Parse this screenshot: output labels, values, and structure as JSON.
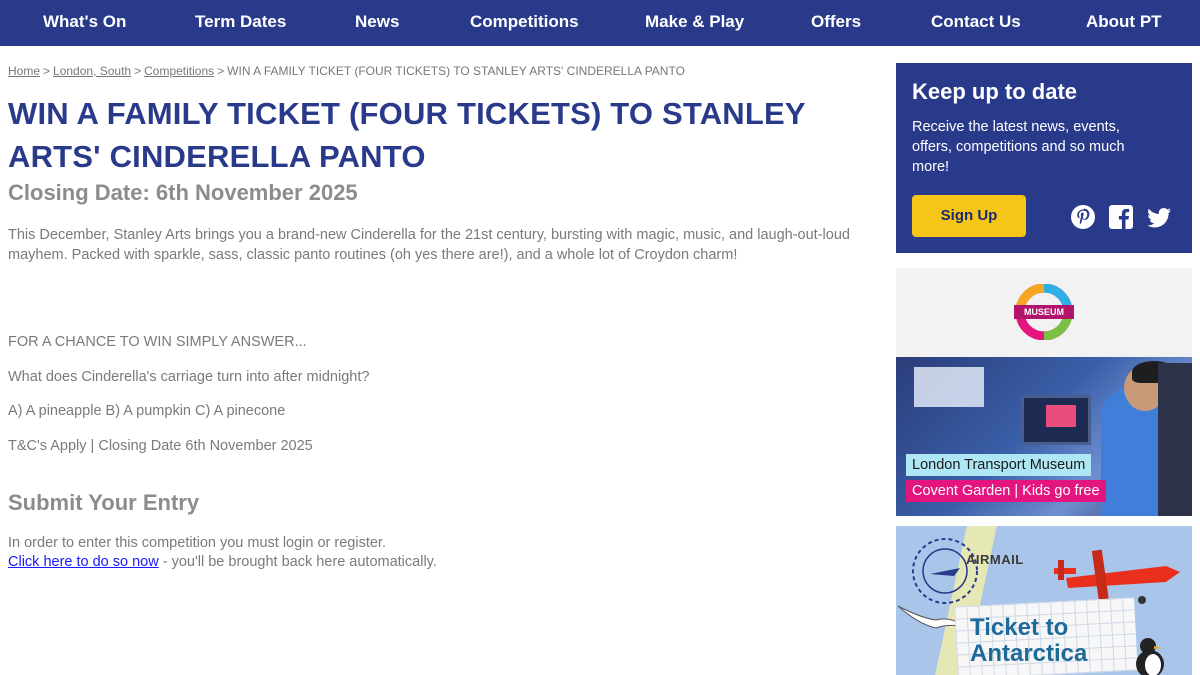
{
  "nav": {
    "items": [
      {
        "label": "What's On"
      },
      {
        "label": "Term Dates"
      },
      {
        "label": "News"
      },
      {
        "label": "Competitions"
      },
      {
        "label": "Make & Play"
      },
      {
        "label": "Offers"
      },
      {
        "label": "Contact Us"
      },
      {
        "label": "About PT"
      }
    ]
  },
  "breadcrumb": {
    "home": "Home",
    "region": "London, South",
    "section": "Competitions",
    "current": "WIN A FAMILY TICKET (FOUR TICKETS) TO STANLEY ARTS' CINDERELLA PANTO"
  },
  "article": {
    "title": "WIN A FAMILY TICKET (FOUR TICKETS) TO STANLEY ARTS' CINDERELLA PANTO",
    "closing_date": "Closing Date: 6th November 2025",
    "intro": "This December, Stanley Arts  brings you a brand-new Cinderella  for the 21st century, bursting with magic, music, and laugh-out-loud mayhem. Packed with sparkle, sass, classic panto routines (oh yes there are!), and a whole lot of Croydon charm!",
    "prompt": "FOR A CHANCE TO WIN SIMPLY ANSWER...",
    "question": "What does Cinderella's carriage turn into after midnight?",
    "options": "A) A pineapple B) A pumpkin C) A pinecone",
    "terms": "T&C's Apply | Closing Date 6th November 2025"
  },
  "entry": {
    "heading": "Submit Your Entry",
    "login_text": "In order to enter this competition you must login or register.",
    "link_text": "Click here to do so now",
    "after_link": " - you'll be brought back here automatically."
  },
  "newsletter": {
    "heading": "Keep up to date",
    "text": "Receive the latest news, events, offers, competitions and so much more!",
    "button": "Sign Up",
    "social": [
      "pinterest-icon",
      "facebook-icon",
      "twitter-icon"
    ]
  },
  "ad1": {
    "logo_text": "MUSEUM",
    "label1": "London Transport Museum",
    "label2": "Covent Garden | Kids go free"
  },
  "ad2": {
    "stamp_text": "AIRMAIL",
    "title_line1": "Ticket to",
    "title_line2": "Antarctica"
  },
  "colors": {
    "brand_blue": "#2a3a8a",
    "accent_yellow": "#f5c518",
    "label_cyan": "#aee6f5",
    "label_magenta": "#e5157f"
  }
}
